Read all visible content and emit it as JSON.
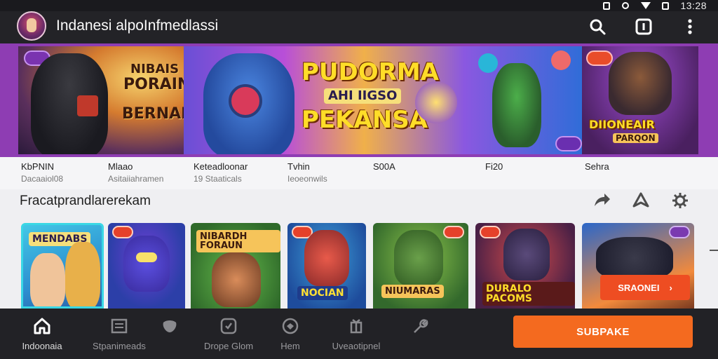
{
  "status_bar": {
    "time": "13:28"
  },
  "app_bar": {
    "title": "Indanesi alpoInfmedlassi"
  },
  "hero": {
    "panel1": {
      "line1": "NIBAIS",
      "line2": "PORAIN",
      "line3": "BERNAISI"
    },
    "panel2": {
      "line1": "PUDORMA",
      "line2": "AHI IIGSO",
      "line3": "PEKANSA"
    },
    "panel3": {
      "line1": "DIIONEAIR",
      "line2": "PARQON"
    }
  },
  "categories": [
    {
      "label": "KbPNIN",
      "sub": "Dacaaiol08"
    },
    {
      "label": "Mlaao",
      "sub": "Asitaiiahramen"
    },
    {
      "label": "Keteadloonar",
      "sub": "19 Staaticals"
    },
    {
      "label": "Tvhin",
      "sub": "Ieoeonwils"
    },
    {
      "label": "S00A",
      "sub": ""
    },
    {
      "label": "Fi20",
      "sub": ""
    },
    {
      "label": "Sehra",
      "sub": ""
    }
  ],
  "section": {
    "title": "Fracatprandlarerekam"
  },
  "cards": [
    {
      "title": "MENDABS"
    },
    {
      "title": ""
    },
    {
      "title": "NIBARDH FORAUN"
    },
    {
      "title": "NOCIAN"
    },
    {
      "title": "NIUMARAS"
    },
    {
      "title": "DURALO PACOMS"
    },
    {
      "title": ""
    }
  ],
  "cta_small": {
    "label": "SRAONEI",
    "arrow": "›"
  },
  "bottom_nav": [
    {
      "label": "Indoonaia",
      "icon": "home-icon"
    },
    {
      "label": "Stpanimeads",
      "icon": "newspaper-icon"
    },
    {
      "label": "Drope Glom",
      "icon": "clock-icon"
    },
    {
      "label": "Hem",
      "icon": "globe-icon"
    },
    {
      "label": "Uveaotipnel",
      "icon": "gift-icon"
    }
  ],
  "subscribe": {
    "label": "SUBPAKE"
  },
  "colors": {
    "accent": "#f46a1f",
    "hero_bg": "#8e3db3",
    "nav_bg": "#222226"
  }
}
